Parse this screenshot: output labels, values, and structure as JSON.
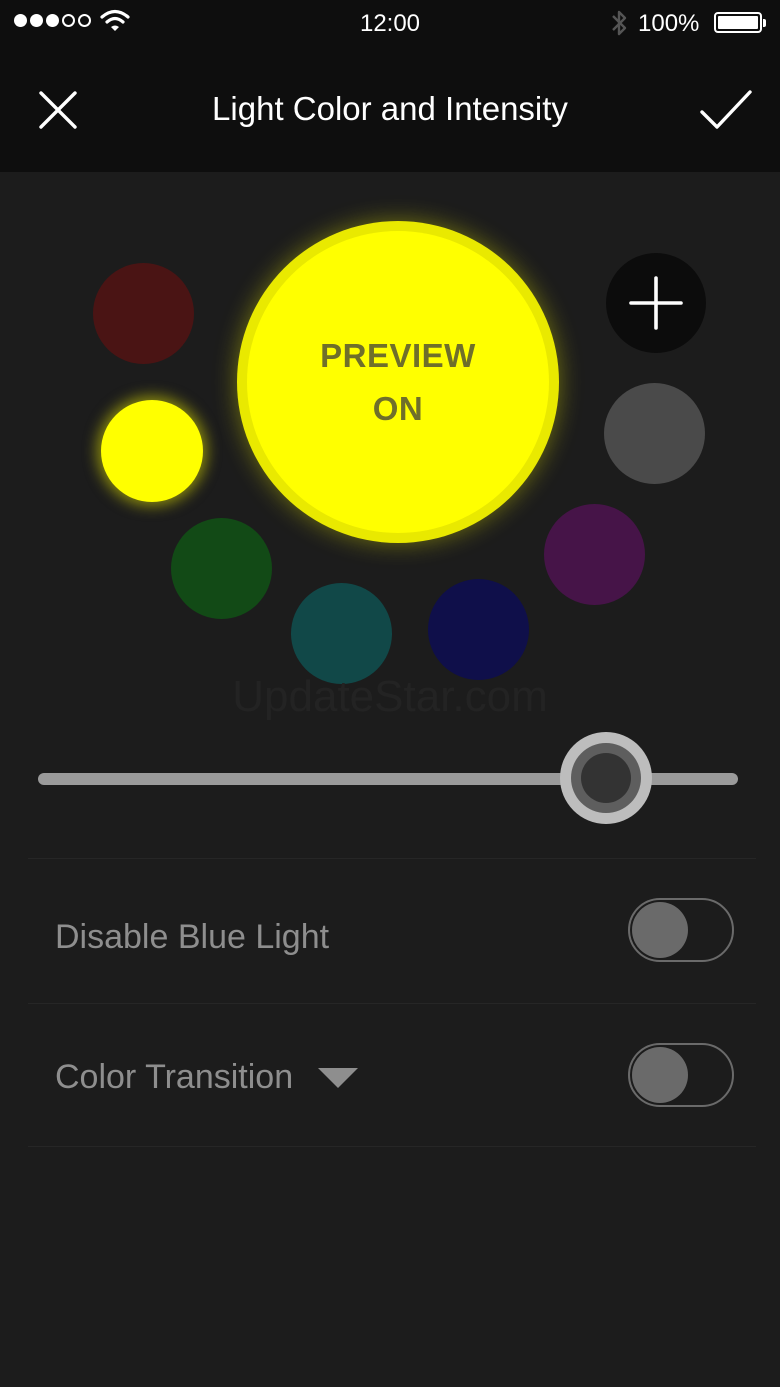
{
  "status_bar": {
    "signal_dots_filled": 3,
    "signal_dots_total": 5,
    "time": "12:00",
    "battery_percent": "100%"
  },
  "header": {
    "title": "Light Color and Intensity",
    "close_icon": "close-x-icon",
    "confirm_icon": "checkmark-icon"
  },
  "preview": {
    "line1": "PREVIEW",
    "line2": "ON",
    "color": "#ffff00"
  },
  "swatches": [
    {
      "name": "dark-red",
      "color": "#4a1414",
      "selected": false
    },
    {
      "name": "yellow",
      "color": "#ffff00",
      "selected": true
    },
    {
      "name": "green",
      "color": "#124a16",
      "selected": false
    },
    {
      "name": "teal",
      "color": "#114848",
      "selected": false
    },
    {
      "name": "navy",
      "color": "#0f0f4a",
      "selected": false
    },
    {
      "name": "purple",
      "color": "#461448",
      "selected": false
    },
    {
      "name": "gray",
      "color": "#4a4a4a",
      "selected": false
    }
  ],
  "add_color_icon": "plus-icon",
  "watermark": "UpdateStar.com",
  "intensity": {
    "value_fraction": 0.81
  },
  "settings": {
    "disable_blue_light": {
      "label": "Disable Blue Light",
      "enabled": false
    },
    "color_transition": {
      "label": "Color Transition",
      "enabled": false,
      "dropdown_icon": "caret-down-icon"
    }
  },
  "colors": {
    "background": "#1c1c1c",
    "header_background": "#0e0e0e",
    "accent": "#ffff00"
  }
}
